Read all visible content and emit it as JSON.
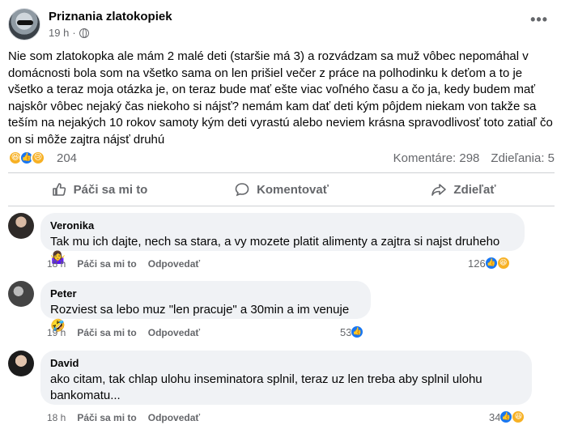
{
  "post": {
    "page_name": "Priznania zlatokopiek",
    "time": "19 h",
    "separator": "·",
    "text": "Nie som zlatokopka ale mám 2 malé deti (staršie má 3) a rozvádzam sa muž vôbec nepomáhal v domácnosti bola som na všetko sama on len prišiel večer z práce na polhodinku k deťom a to je všetko a teraz moja otázka je, on teraz bude mať ešte viac voľného času a čo ja, kedy budem mať najskôr vôbec nejaký čas niekoho si nájsť? nemám kam dať deti kým pôjdem niekam von takže sa teším na nejakých 10 rokov samoty kým deti vyrastú alebo neviem krásna spravodlivosť toto zatiaľ čo on si môže zajtra nájsť druhú",
    "reactions": [
      "haha",
      "like",
      "sad"
    ],
    "reaction_count": "204",
    "comments_stat": "Komentáre: 298",
    "shares_stat": "Zdieľania: 5"
  },
  "actions": {
    "like": "Páči sa mi to",
    "comment": "Komentovať",
    "share": "Zdieľať"
  },
  "comments": [
    {
      "author": "Veronika",
      "text": "Tak mu ich dajte, nech sa stara, a vy mozete platit alimenty a zajtra si najst druheho 🤷‍♀️",
      "time": "18 h",
      "like_label": "Páči sa mi to",
      "reply_label": "Odpovedať",
      "reaction_count": "126",
      "reactions": [
        "like",
        "haha"
      ]
    },
    {
      "author": "Peter",
      "text": "Rozviest sa lebo muz \"len pracuje\" a 30min a im venuje 🤣",
      "time": "19 h",
      "like_label": "Páči sa mi to",
      "reply_label": "Odpovedať",
      "reaction_count": "53",
      "reactions": [
        "like"
      ]
    },
    {
      "author": "David",
      "text_line1": "ako citam, tak chlap ulohu inseminatora splnil, teraz uz len treba aby splnil ulohu",
      "text_line2": "bankomatu...",
      "time": "18 h",
      "like_label": "Páči sa mi to",
      "reply_label": "Odpovedať",
      "reaction_count": "34",
      "reactions": [
        "like",
        "haha"
      ]
    }
  ],
  "icons": {
    "haha_glyph": "😆",
    "like_glyph": "👍",
    "sad_glyph": "😢",
    "more_glyph": "•••"
  },
  "colors": {
    "accent": "#1877f2",
    "secondary_text": "#65676b",
    "bubble": "#f0f2f5"
  }
}
